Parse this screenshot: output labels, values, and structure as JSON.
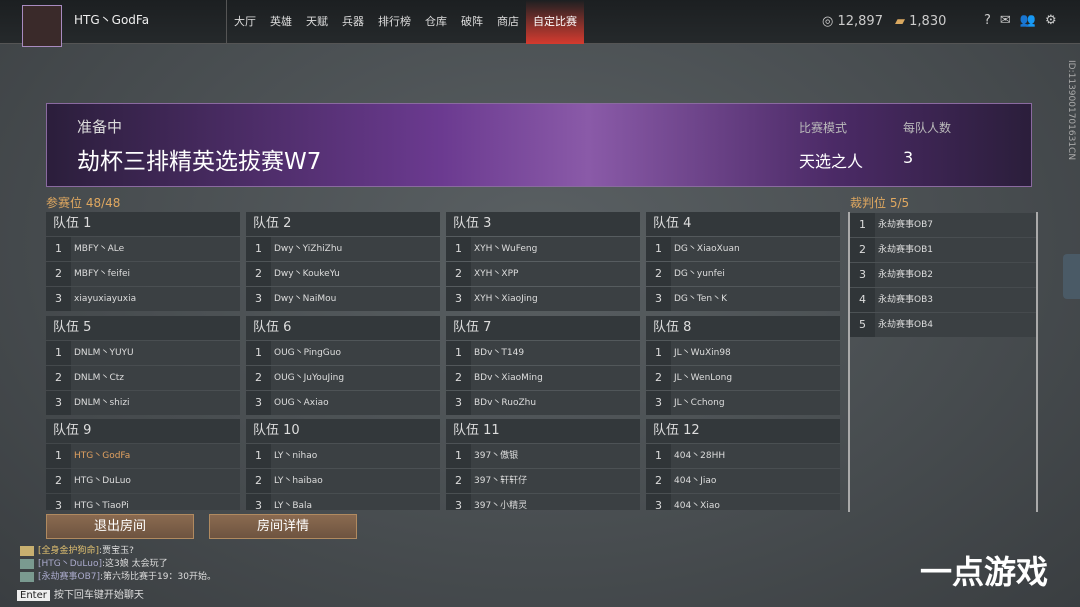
{
  "header": {
    "username": "HTG丶GodFa",
    "nav": [
      "大厅",
      "英雄",
      "天赋",
      "兵器",
      "排行榜",
      "仓库",
      "破阵",
      "商店",
      "自定比赛"
    ],
    "active_nav": "自定比赛",
    "currency1": "12,897",
    "currency2": "1,830",
    "icons": [
      "help-icon",
      "mail-icon",
      "friends-icon",
      "settings-icon"
    ]
  },
  "banner": {
    "status": "准备中",
    "title": "劫杯三排精英选拔赛W7",
    "mode_label": "比赛模式",
    "mode_value": "天选之人",
    "size_label": "每队人数",
    "size_value": "3"
  },
  "participants": {
    "label": "参赛位",
    "count": "48/48"
  },
  "teams": [
    {
      "name": "队伍 1",
      "players": [
        "MBFY丶ALe",
        "MBFY丶feifei",
        "xiayuxiayuxia"
      ]
    },
    {
      "name": "队伍 2",
      "players": [
        "Dwy丶YiZhiZhu",
        "Dwy丶KoukeYu",
        "Dwy丶NaiMou"
      ]
    },
    {
      "name": "队伍 3",
      "players": [
        "XYH丶WuFeng",
        "XYH丶XPP",
        "XYH丶XiaoJing"
      ]
    },
    {
      "name": "队伍 4",
      "players": [
        "DG丶XiaoXuan",
        "DG丶yunfei",
        "DG丶Ten丶K"
      ]
    },
    {
      "name": "队伍 5",
      "players": [
        "DNLM丶YUYU",
        "DNLM丶Ctz",
        "DNLM丶shizi"
      ]
    },
    {
      "name": "队伍 6",
      "players": [
        "OUG丶PingGuo",
        "OUG丶JuYouJing",
        "OUG丶Axiao"
      ]
    },
    {
      "name": "队伍 7",
      "players": [
        "BDv丶T149",
        "BDv丶XiaoMing",
        "BDv丶RuoZhu"
      ]
    },
    {
      "name": "队伍 8",
      "players": [
        "JL丶WuXin98",
        "JL丶WenLong",
        "JL丶Cchong"
      ]
    },
    {
      "name": "队伍 9",
      "players": [
        "HTG丶GodFa",
        "HTG丶DuLuo",
        "HTG丶TiaoPi"
      ]
    },
    {
      "name": "队伍 10",
      "players": [
        "LY丶nihao",
        "LY丶haibao",
        "LY丶Bala"
      ]
    },
    {
      "name": "队伍 11",
      "players": [
        "397丶傲银",
        "397丶轩轩仔",
        "397丶小精灵"
      ]
    },
    {
      "name": "队伍 12",
      "players": [
        "404丶28HH",
        "404丶Jiao",
        "404丶Xiao"
      ]
    }
  ],
  "referees": {
    "label": "裁判位",
    "count": "5/5",
    "list": [
      "永劫赛事OB7",
      "永劫赛事OB1",
      "永劫赛事OB2",
      "永劫赛事OB3",
      "永劫赛事OB4"
    ]
  },
  "buttons": {
    "leave": "退出房间",
    "details": "房间详情"
  },
  "chat": [
    {
      "who": "[全身金护狗命]",
      "msg": ":贾宝玉?"
    },
    {
      "who": "[HTG丶DuLuo]",
      "msg": ":这3娘 太会玩了"
    },
    {
      "who": "[永劫赛事OB7]",
      "msg": ":第六场比赛于19：30开始。"
    }
  ],
  "enter": {
    "key": "Enter",
    "hint": "按下回车键开始聊天"
  },
  "watermark": "一点游戏",
  "vertical_id": "ID:1139001701631CN"
}
